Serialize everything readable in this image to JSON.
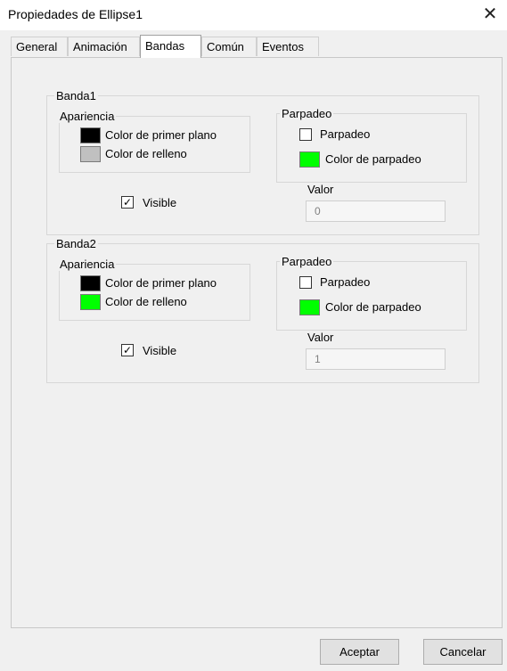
{
  "window": {
    "title": "Propiedades de Ellipse1",
    "close_glyph": "✕"
  },
  "tabs": [
    {
      "label": "General"
    },
    {
      "label": "Animación"
    },
    {
      "label": "Bandas",
      "active": true
    },
    {
      "label": "Común"
    },
    {
      "label": "Eventos"
    }
  ],
  "bands": [
    {
      "title": "Banda1",
      "appearance": {
        "title": "Apariencia",
        "foreground_label": "Color de primer plano",
        "foreground_color": "#000000",
        "fill_label": "Color de relleno",
        "fill_color": "#c0c0c0"
      },
      "blink": {
        "title": "Parpadeo",
        "checkbox_label": "Parpadeo",
        "checked": false,
        "color_label": "Color de parpadeo",
        "color": "#00ff00"
      },
      "visible": {
        "label": "Visible",
        "checked": true,
        "check_glyph": "✓"
      },
      "value": {
        "label": "Valor",
        "value": "0"
      }
    },
    {
      "title": "Banda2",
      "appearance": {
        "title": "Apariencia",
        "foreground_label": "Color de primer plano",
        "foreground_color": "#000000",
        "fill_label": "Color de relleno",
        "fill_color": "#00ff00"
      },
      "blink": {
        "title": "Parpadeo",
        "checkbox_label": "Parpadeo",
        "checked": false,
        "color_label": "Color de parpadeo",
        "color": "#00ff00"
      },
      "visible": {
        "label": "Visible",
        "checked": true,
        "check_glyph": "✓"
      },
      "value": {
        "label": "Valor",
        "value": "1"
      }
    }
  ],
  "buttons": {
    "ok_label": "Aceptar",
    "cancel_label": "Cancelar"
  }
}
